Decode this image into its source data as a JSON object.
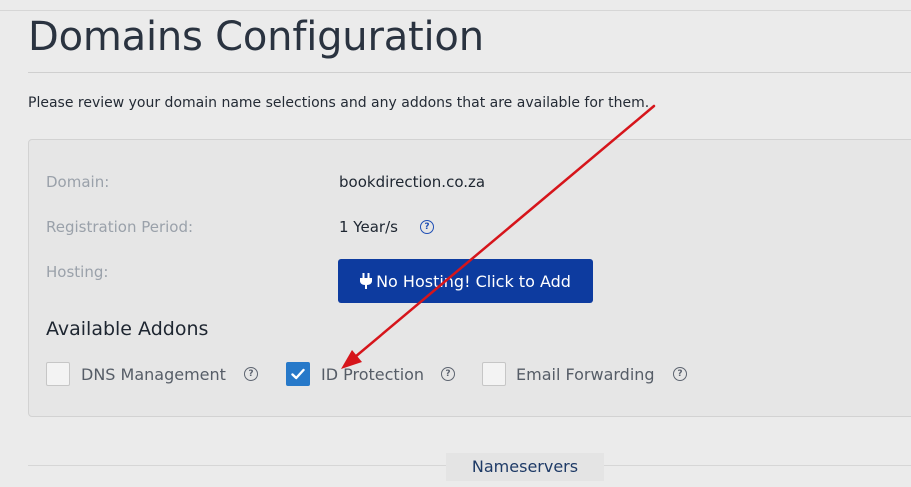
{
  "page": {
    "title": "Domains Configuration",
    "intro": "Please review your domain name selections and any addons that are available for them."
  },
  "domain_panel": {
    "domain_label": "Domain:",
    "domain_value": "bookdirection.co.za",
    "period_label": "Registration Period:",
    "period_value": "1 Year/s",
    "hosting_label": "Hosting:",
    "hosting_button": "No Hosting! Click to Add"
  },
  "addons": {
    "heading": "Available Addons",
    "items": [
      {
        "label": "DNS Management",
        "checked": false
      },
      {
        "label": "ID Protection",
        "checked": true
      },
      {
        "label": "Email Forwarding",
        "checked": false
      }
    ]
  },
  "sections": {
    "nameservers": "Nameservers"
  },
  "colors": {
    "accent_button": "#0d3b9f",
    "checkbox_checked": "#2779c9",
    "annotation_arrow": "#d6151b"
  }
}
